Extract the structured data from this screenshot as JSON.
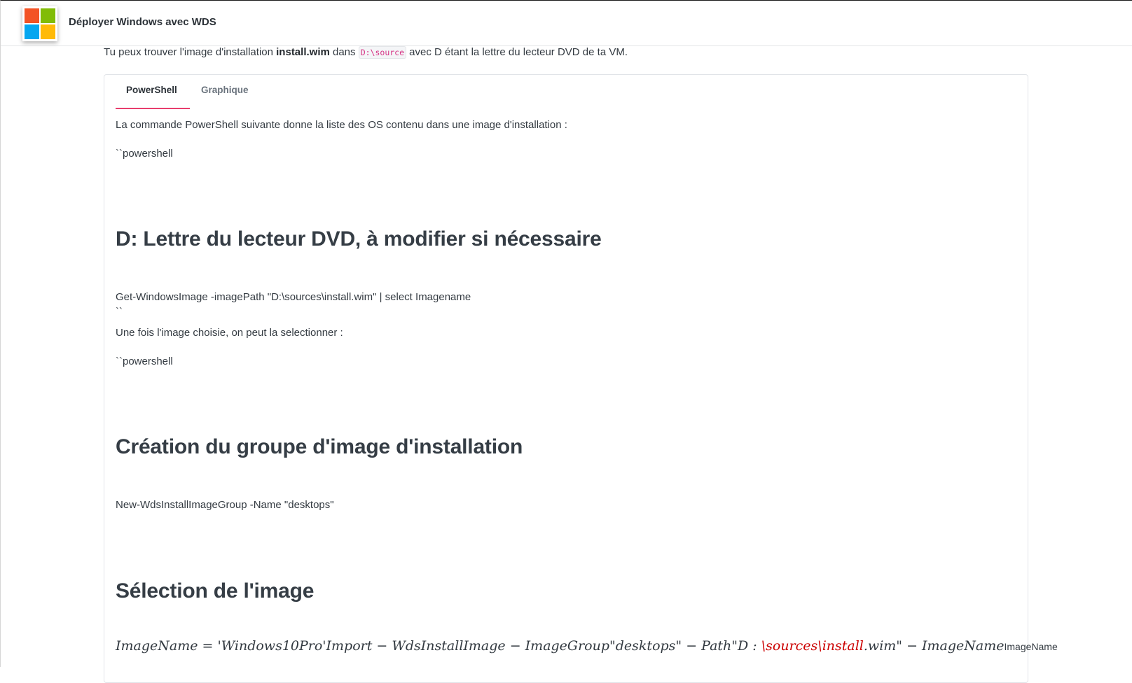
{
  "header": {
    "title": "Déployer Windows avec WDS",
    "logo_icon": "microsoft-windows-logo-icon"
  },
  "intro": {
    "text_before": "Tu peux trouver l'image d'installation ",
    "bold": "install.wim",
    "text_middle": " dans ",
    "code": "D:\\source",
    "text_after": " avec D étant la lettre du lecteur DVD de ta VM."
  },
  "tabs": [
    {
      "label": "PowerShell",
      "active": true
    },
    {
      "label": "Graphique",
      "active": false
    }
  ],
  "content": {
    "p1": "La commande PowerShell suivante donne la liste des OS contenu dans une image d'installation :",
    "fence1": "``powershell",
    "h1": "D: Lettre du lecteur DVD, à modifier si nécessaire",
    "cmd1": "Get-WindowsImage -imagePath \"D:\\sources\\install.wim\" | select Imagename",
    "fence_end": "``",
    "p2": "Une fois l'image choisie, on peut la selectionner :",
    "fence2": "``powershell",
    "h2": "Création du groupe d'image d'installation",
    "cmd2": "New-WdsInstallImageGroup -Name \"desktops\"",
    "h3": "Sélection de l'image",
    "math_part1": "ImageName = 'Windows10Pro'Import − WdsInstallImage − ImageGroup\"desktops\" − Path\"D : ",
    "math_red": "\\sources\\install",
    "math_part2": ".wim\" − ImageName",
    "math_plain": "ImageName"
  },
  "colors": {
    "accent": "#e83e6d",
    "code_text": "#d63384",
    "heading": "#353d45"
  }
}
